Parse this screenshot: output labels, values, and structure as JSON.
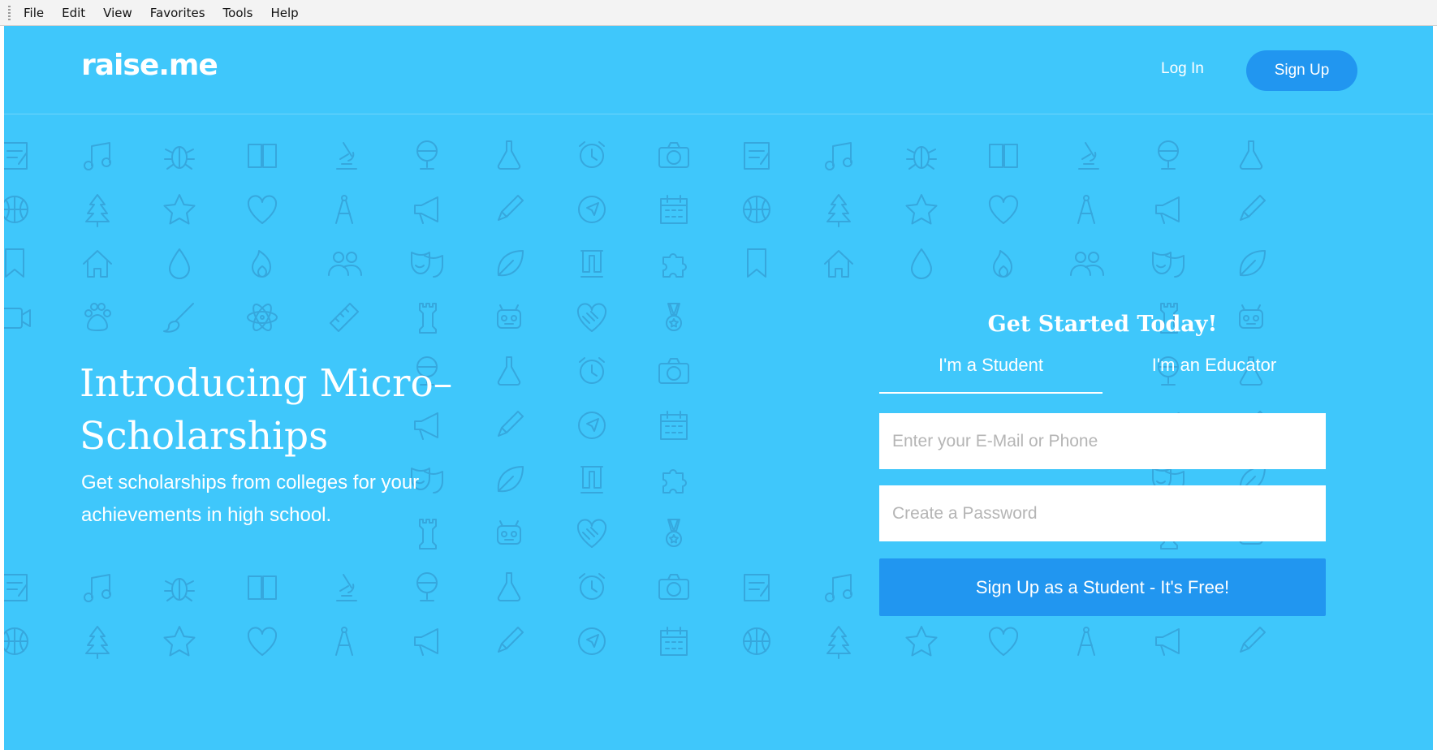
{
  "menubar": {
    "items": [
      "File",
      "Edit",
      "View",
      "Favorites",
      "Tools",
      "Help"
    ]
  },
  "header": {
    "logo": "raise.me",
    "login_label": "Log In",
    "signup_label": "Sign Up"
  },
  "hero": {
    "title": "Introducing Micro–Scholarships",
    "subtitle": "Get scholarships from colleges for your achievements in high school."
  },
  "signup_form": {
    "title": "Get Started Today!",
    "tabs": [
      {
        "label": "I'm a Student",
        "active": true
      },
      {
        "label": "I'm an Educator",
        "active": false
      }
    ],
    "email_placeholder": "Enter your E-Mail or Phone",
    "password_placeholder": "Create a Password",
    "submit_label": "Sign Up as a Student - It's Free!"
  },
  "colors": {
    "background": "#3fc7fb",
    "button": "#2196f0",
    "pattern_icon": "#36a7dd"
  },
  "pattern_icons": [
    [
      "note-icon",
      "music-icon",
      "bug-icon",
      "book-icon",
      "microscope-icon",
      "globe-icon",
      "flask-icon",
      "alarm-clock-icon",
      "camera-icon",
      "note-icon",
      "music-icon",
      "bug-icon",
      "book-icon",
      "microscope-icon",
      "globe-icon",
      "flask-icon"
    ],
    [
      "basketball-icon",
      "tree-icon",
      "star-icon",
      "heart-icon",
      "compass-icon",
      "megaphone-icon",
      "pencil-icon",
      "navigation-icon",
      "calendar-icon",
      "basketball-icon",
      "tree-icon",
      "star-icon",
      "heart-icon",
      "compass-icon",
      "megaphone-icon",
      "pencil-icon"
    ],
    [
      "bookmark-icon",
      "house-icon",
      "drop-icon",
      "flame-icon",
      "people-icon",
      "masks-icon",
      "leaf-icon",
      "university-icon",
      "puzzle-icon",
      "bookmark-icon",
      "house-icon",
      "drop-icon",
      "flame-icon",
      "people-icon",
      "masks-icon",
      "leaf-icon"
    ],
    [
      "video-icon",
      "paw-icon",
      "brush-icon",
      "atom-icon",
      "ruler-icon",
      "rook-icon",
      "robot-icon",
      "handshake-icon",
      "medal-icon",
      "video-icon",
      "paw-icon",
      "brush-icon",
      "atom-icon",
      "ruler-icon",
      "rook-icon",
      "robot-icon"
    ]
  ]
}
